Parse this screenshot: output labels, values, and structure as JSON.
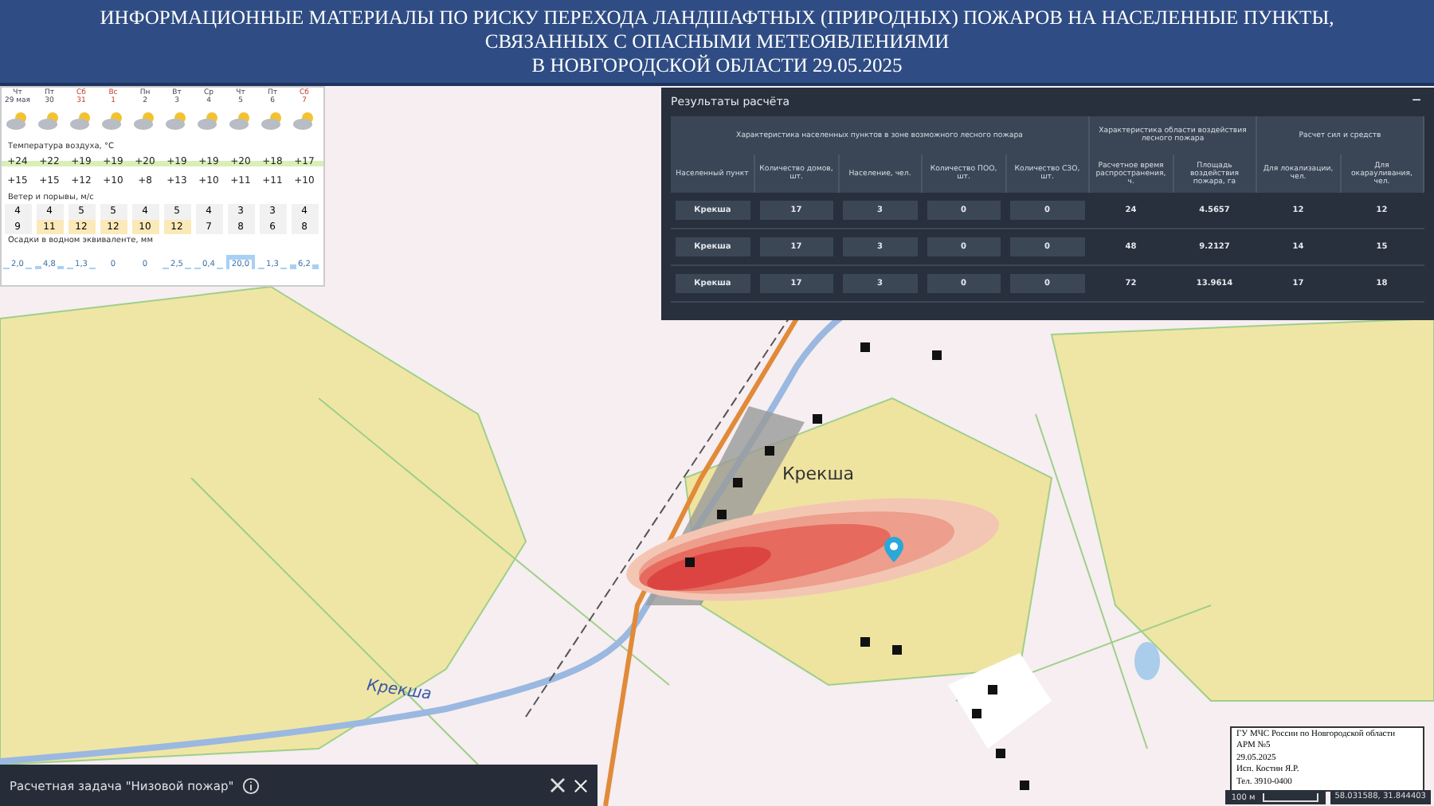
{
  "title": {
    "lines": [
      "ИНФОРМАЦИОННЫЕ МАТЕРИАЛЫ ПО РИСКУ ПЕРЕХОДА ЛАНДШАФТНЫХ (ПРИРОДНЫХ) ПОЖАРОВ НА НАСЕЛЕННЫЕ ПУНКТЫ,",
      "СВЯЗАННЫХ С ОПАСНЫМИ МЕТЕОЯВЛЕНИЯМИ",
      "В НОВГОРОДСКОЙ ОБЛАСТИ 29.05.2025"
    ]
  },
  "weather": {
    "temp_label": "Температура воздуха, °C",
    "wind_label": "Ветер и порывы, м/с",
    "precip_label": "Осадки в водном эквиваленте, мм",
    "days": [
      {
        "dow": "Чт",
        "date": "29 мая",
        "weekend": false,
        "high": "+24",
        "low": "+15",
        "wind": "4",
        "gust": "9",
        "precip": "2,0"
      },
      {
        "dow": "Пт",
        "date": "30",
        "weekend": false,
        "high": "+22",
        "low": "+15",
        "wind": "4",
        "gust": "11",
        "precip": "4,8"
      },
      {
        "dow": "Сб",
        "date": "31",
        "weekend": true,
        "high": "+19",
        "low": "+12",
        "wind": "5",
        "gust": "12",
        "precip": "1,3"
      },
      {
        "dow": "Вс",
        "date": "1",
        "weekend": true,
        "high": "+19",
        "low": "+10",
        "wind": "5",
        "gust": "12",
        "precip": "0"
      },
      {
        "dow": "Пн",
        "date": "2",
        "weekend": false,
        "high": "+20",
        "low": "+8",
        "wind": "4",
        "gust": "10",
        "precip": "0"
      },
      {
        "dow": "Вт",
        "date": "3",
        "weekend": false,
        "high": "+19",
        "low": "+13",
        "wind": "5",
        "gust": "12",
        "precip": "2,5"
      },
      {
        "dow": "Ср",
        "date": "4",
        "weekend": false,
        "high": "+19",
        "low": "+10",
        "wind": "4",
        "gust": "7",
        "precip": "0,4"
      },
      {
        "dow": "Чт",
        "date": "5",
        "weekend": false,
        "high": "+20",
        "low": "+11",
        "wind": "3",
        "gust": "8",
        "precip": "20,0"
      },
      {
        "dow": "Пт",
        "date": "6",
        "weekend": false,
        "high": "+18",
        "low": "+11",
        "wind": "3",
        "gust": "6",
        "precip": "1,3"
      },
      {
        "dow": "Сб",
        "date": "7",
        "weekend": true,
        "high": "+17",
        "low": "+10",
        "wind": "4",
        "gust": "8",
        "precip": "6,2"
      }
    ]
  },
  "results": {
    "title": "Результаты расчёта",
    "collapse": "−",
    "groups": [
      "Характеристика населенных пунктов в зоне возможного лесного пожара",
      "Характеристика области воздействия лесного пожара",
      "Расчет сил и средств"
    ],
    "columns": [
      "Населенный пункт",
      "Количество домов, шт.",
      "Население, чел.",
      "Количество ПОО, шт.",
      "Количество СЗО, шт.",
      "Расчетное время распространения, ч.",
      "Площадь воздействия пожара, га",
      "Для локализации, чел.",
      "Для окарауливания, чел."
    ],
    "rows": [
      [
        "Крекша",
        "17",
        "3",
        "0",
        "0",
        "24",
        "4.5657",
        "12",
        "12"
      ],
      [
        "Крекша",
        "17",
        "3",
        "0",
        "0",
        "48",
        "9.2127",
        "14",
        "15"
      ],
      [
        "Крекша",
        "17",
        "3",
        "0",
        "0",
        "72",
        "13.9614",
        "17",
        "18"
      ]
    ]
  },
  "map": {
    "settlement": "Крекша",
    "river": "Крекша"
  },
  "stamp": {
    "lines": [
      "ГУ МЧС России по Новгородской области",
      "АРМ №5",
      "29.05.2025",
      "Исп. Костин Я.Р.",
      "Тел. 3910-0400"
    ]
  },
  "scale": {
    "label": "100 м",
    "coords": "58.031588, 31.844403"
  },
  "task": {
    "label": "Расчетная задача \"Низовой пожар\""
  }
}
